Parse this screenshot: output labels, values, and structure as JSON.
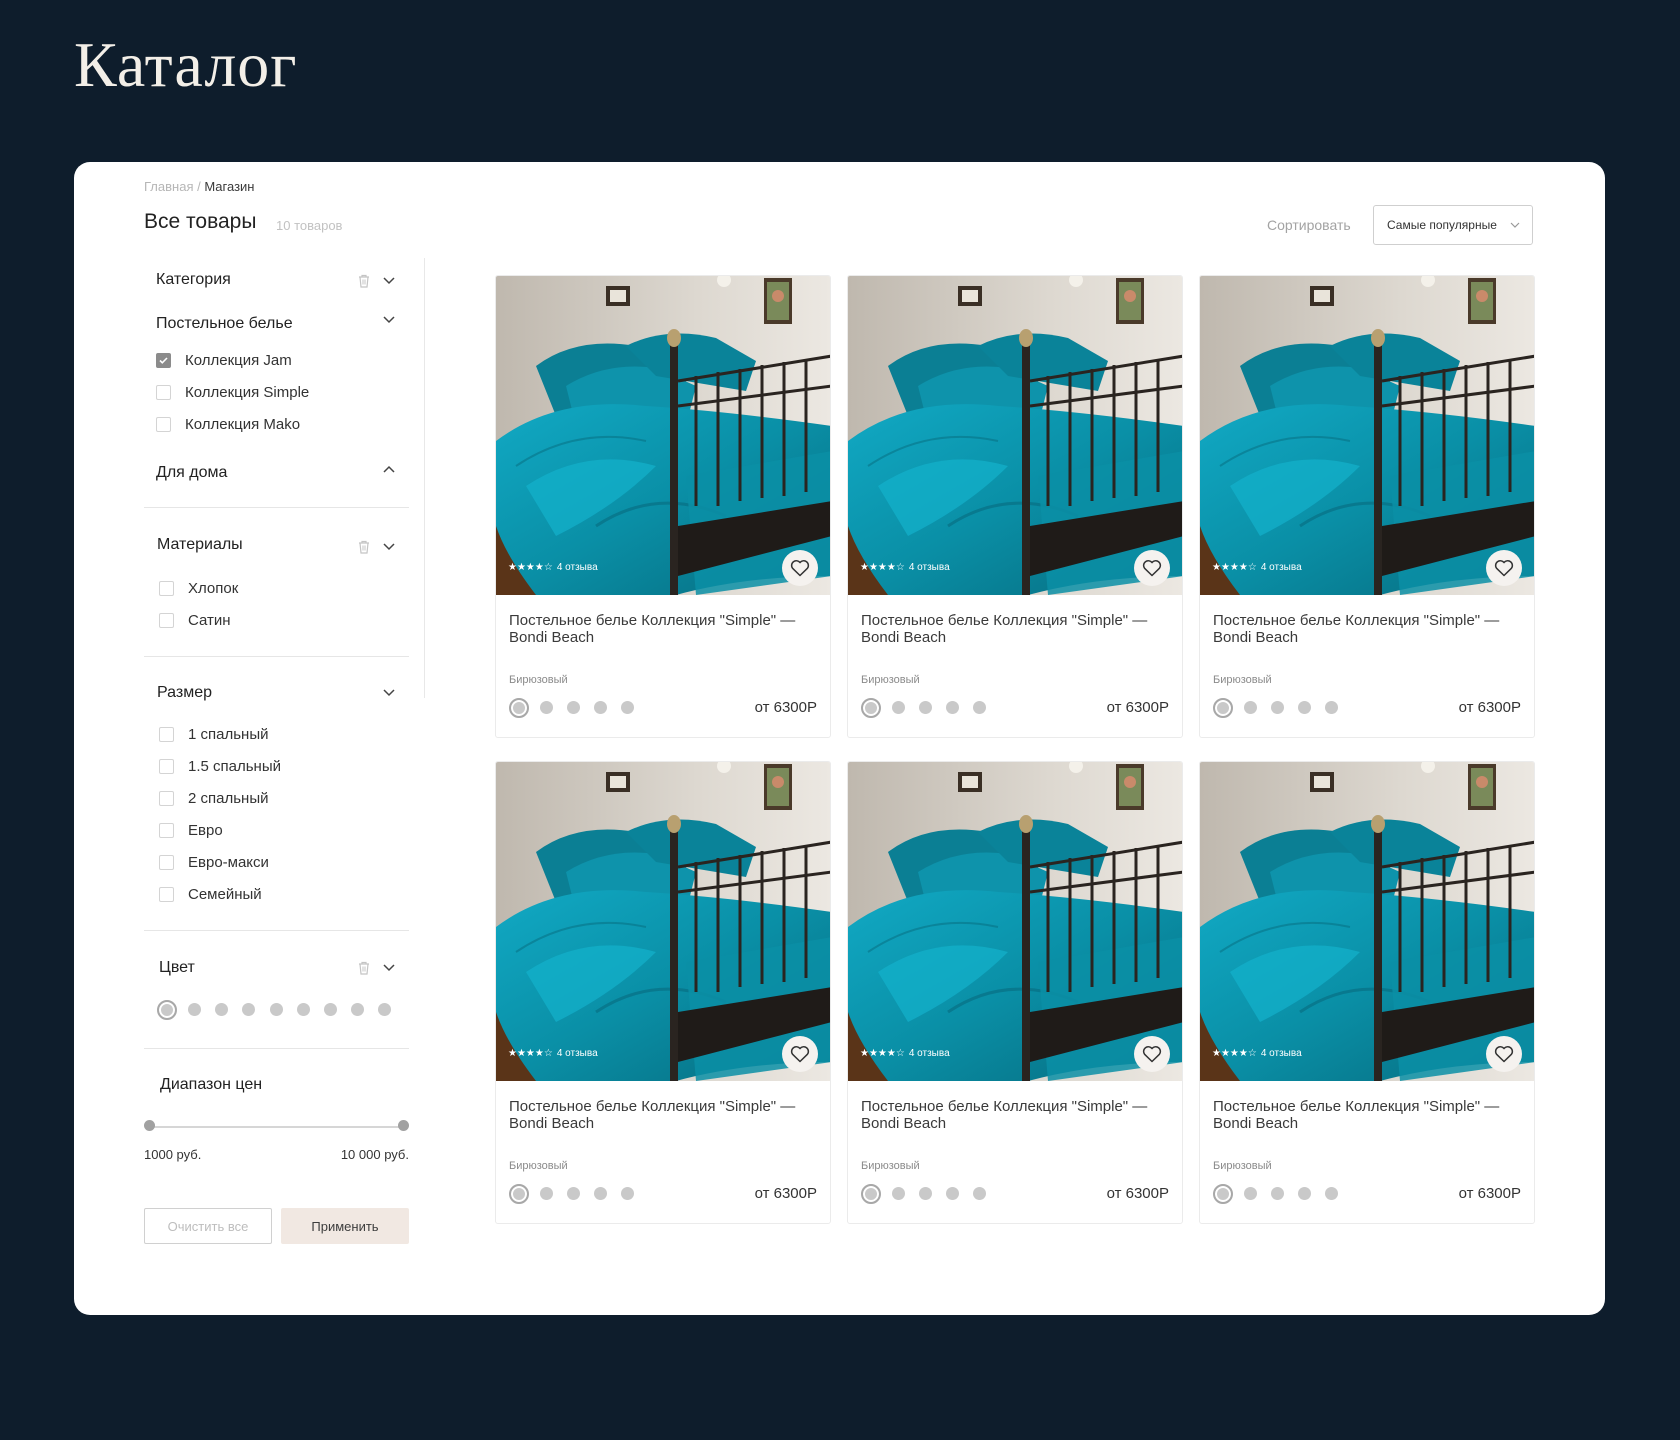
{
  "hero_title": "Каталог",
  "breadcrumb": {
    "home": "Главная",
    "separator": " / ",
    "current": "Магазин"
  },
  "page_title": "Все товары",
  "product_count": "10 товаров",
  "sort": {
    "label": "Сортировать",
    "selected": "Самые популярные"
  },
  "filters": {
    "category": {
      "title": "Категория",
      "groups": [
        {
          "title": "Постельное белье",
          "items": [
            {
              "label": "Коллекция Jam",
              "checked": true
            },
            {
              "label": "Коллекция Simple",
              "checked": false
            },
            {
              "label": "Коллекция Mako",
              "checked": false
            }
          ]
        },
        {
          "title": "Для дома",
          "items": []
        }
      ]
    },
    "materials": {
      "title": "Материалы",
      "items": [
        {
          "label": "Хлопок",
          "checked": false
        },
        {
          "label": "Сатин",
          "checked": false
        }
      ]
    },
    "size": {
      "title": "Размер",
      "items": [
        {
          "label": "1 спальный",
          "checked": false
        },
        {
          "label": "1.5 спальный",
          "checked": false
        },
        {
          "label": "2 спальный",
          "checked": false
        },
        {
          "label": "Евро",
          "checked": false
        },
        {
          "label": "Евро-макси",
          "checked": false
        },
        {
          "label": "Семейный",
          "checked": false
        }
      ]
    },
    "color": {
      "title": "Цвет",
      "swatch_count": 9,
      "selected_index": 0
    },
    "price_range": {
      "title": "Диапазон цен",
      "min_label": "1000 руб.",
      "max_label": "10 000 руб."
    }
  },
  "buttons": {
    "clear": "Очистить все",
    "apply": "Применить"
  },
  "products": [
    {
      "name": "Постельное белье Коллекция \"Simple\" — Bondi Beach",
      "color": "Бирюзовый",
      "price": "от 6300Р",
      "stars": "★★★★☆",
      "reviews": "4 отзыва"
    },
    {
      "name": "Постельное белье Коллекция \"Simple\" — Bondi Beach",
      "color": "Бирюзовый",
      "price": "от 6300Р",
      "stars": "★★★★☆",
      "reviews": "4 отзыва"
    },
    {
      "name": "Постельное белье Коллекция \"Simple\" — Bondi Beach",
      "color": "Бирюзовый",
      "price": "от 6300Р",
      "stars": "★★★★☆",
      "reviews": "4 отзыва"
    },
    {
      "name": "Постельное белье Коллекция \"Simple\" — Bondi Beach",
      "color": "Бирюзовый",
      "price": "от 6300Р",
      "stars": "★★★★☆",
      "reviews": "4 отзыва"
    },
    {
      "name": "Постельное белье Коллекция \"Simple\" — Bondi Beach",
      "color": "Бирюзовый",
      "price": "от 6300Р",
      "stars": "★★★★☆",
      "reviews": "4 отзыва"
    },
    {
      "name": "Постельное белье Коллекция \"Simple\" — Bondi Beach",
      "color": "Бирюзовый",
      "price": "от 6300Р",
      "stars": "★★★★☆",
      "reviews": "4 отзыва"
    }
  ],
  "colors": {
    "background": "#0e1d2c",
    "accent_apply": "#f1e8e2",
    "bedding": "#0a8fa6"
  }
}
